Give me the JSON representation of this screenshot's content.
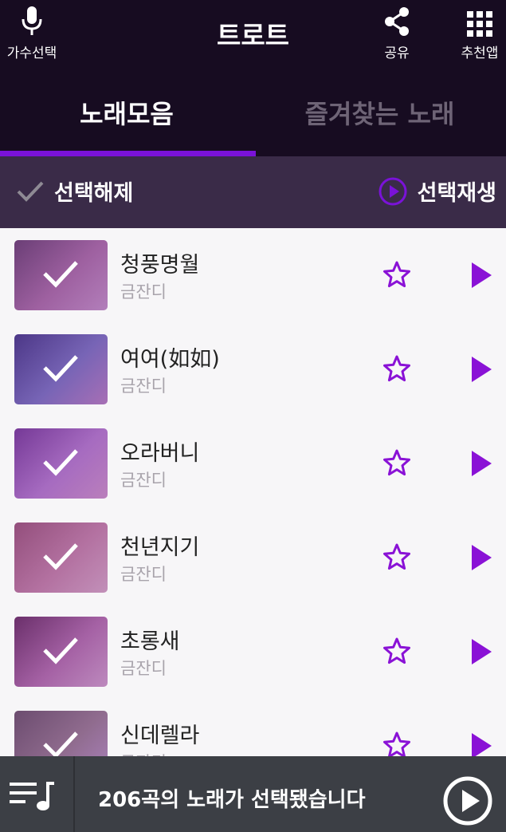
{
  "header": {
    "title": "트로트",
    "singer_select_label": "가수선택",
    "share_label": "공유",
    "recommend_label": "추천앱"
  },
  "tabs": [
    {
      "label": "노래모음",
      "active": true
    },
    {
      "label": "즐겨찾는 노래",
      "active": false
    }
  ],
  "selection_bar": {
    "deselect_label": "선택해제",
    "play_selected_label": "선택재생"
  },
  "songs": [
    {
      "title": "청풍명월",
      "artist": "금잔디",
      "thumb_colors": [
        "#6a5566",
        "#b98aa7",
        "#d8b8cf"
      ],
      "checked": true
    },
    {
      "title": "여여(如如)",
      "artist": "금잔디",
      "thumb_colors": [
        "#3b4a80",
        "#7d90c8",
        "#c7a0c7"
      ],
      "checked": true
    },
    {
      "title": "오라버니",
      "artist": "금잔디",
      "thumb_colors": [
        "#7a4d98",
        "#c59ad8",
        "#e4b9d1"
      ],
      "checked": true
    },
    {
      "title": "천년지기",
      "artist": "금잔디",
      "thumb_colors": [
        "#a86e6f",
        "#d9a3a7",
        "#f0d3cd"
      ],
      "checked": true
    },
    {
      "title": "초롱새",
      "artist": "금잔디",
      "thumb_colors": [
        "#6a3f55",
        "#c38bad",
        "#e8c9d4"
      ],
      "checked": true
    },
    {
      "title": "신데렐라",
      "artist": "금잔디",
      "thumb_colors": [
        "#6c6b5c",
        "#a39b8b",
        "#cbbdd0"
      ],
      "checked": true
    }
  ],
  "bottom_bar": {
    "status_text": "206곡의 노래가 선택됐습니다"
  },
  "colors": {
    "accent": "#7a12d8",
    "header_bg": "#170c21",
    "selection_bar_bg": "#3a2b48",
    "bottom_bar_bg": "#3c3f45"
  }
}
